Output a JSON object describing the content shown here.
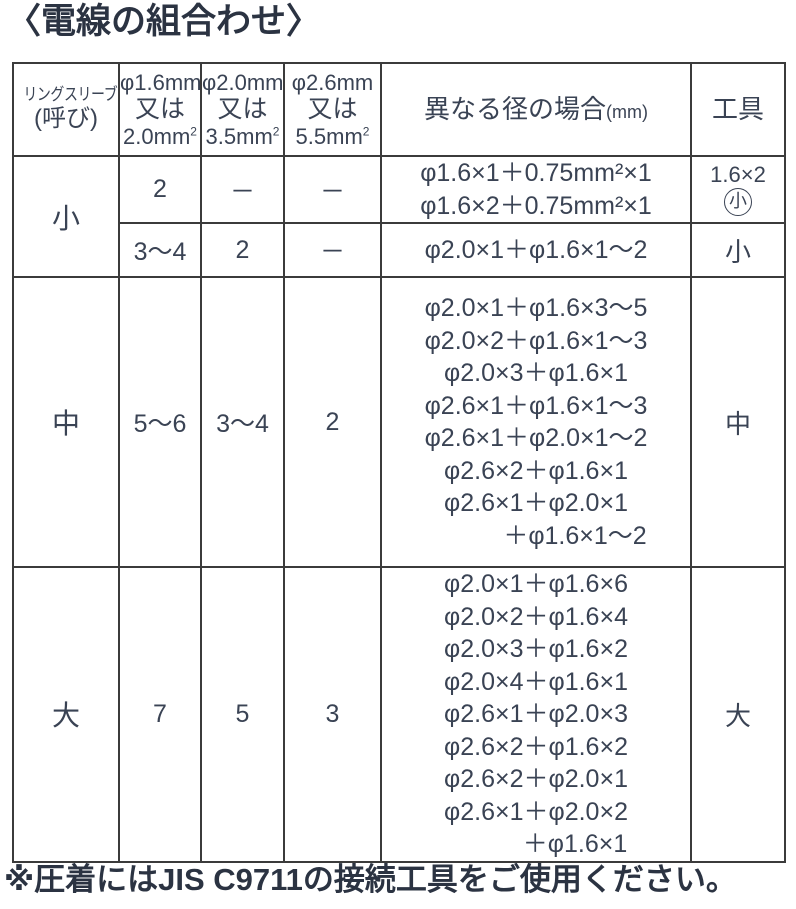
{
  "title": "〈電線の組合わせ〉",
  "table": {
    "headers": {
      "ring_sleeve_line1": "リングスリーブ",
      "ring_sleeve_line2": "(呼び)",
      "dia16_line1": "φ1.6mm",
      "dia16_line2": "又は",
      "dia16_line3": "2.0mm",
      "dia16_sup": "2",
      "dia20_line1": "φ2.0mm",
      "dia20_line2": "又は",
      "dia20_line3": "3.5mm",
      "dia20_sup": "2",
      "dia26_line1": "φ2.6mm",
      "dia26_line2": "又は",
      "dia26_line3": "5.5mm",
      "dia26_sup": "2",
      "mixed": "異なる径の場合",
      "mixed_unit": "(mm)",
      "tool": "工具"
    },
    "rows": [
      {
        "sleeve": "小",
        "subrows": [
          {
            "dia16": "2",
            "dia20": "－",
            "dia26": "－",
            "mixed_lines": [
              "φ1.6×1＋0.75mm²×1",
              "φ1.6×2＋0.75mm²×1"
            ],
            "tool_line1": "1.6×2",
            "tool_line2": "小"
          },
          {
            "dia16": "3～4",
            "dia20": "2",
            "dia26": "－",
            "mixed_lines": [
              "φ2.0×1＋φ1.6×1～2"
            ],
            "tool": "小"
          }
        ]
      },
      {
        "sleeve": "中",
        "dia16": "5～6",
        "dia20": "3～4",
        "dia26": "2",
        "mixed_lines": [
          "φ2.0×1＋φ1.6×3～5",
          "φ2.0×2＋φ1.6×1～3",
          "φ2.0×3＋φ1.6×1",
          "φ2.6×1＋φ1.6×1～3",
          "φ2.6×1＋φ2.0×1～2",
          "φ2.6×2＋φ1.6×1",
          "φ2.6×1＋φ2.0×1",
          "＋φ1.6×1～2"
        ],
        "mixed_last_indented": true,
        "tool": "中"
      },
      {
        "sleeve": "大",
        "dia16": "7",
        "dia20": "5",
        "dia26": "3",
        "mixed_lines": [
          "φ2.0×1＋φ1.6×6",
          "φ2.0×2＋φ1.6×4",
          "φ2.0×3＋φ1.6×2",
          "φ2.0×4＋φ1.6×1",
          "φ2.6×1＋φ2.0×3",
          "φ2.6×2＋φ1.6×2",
          "φ2.6×2＋φ2.0×1",
          "φ2.6×1＋φ2.0×2",
          "＋φ1.6×1"
        ],
        "mixed_last_indented": true,
        "tool": "大"
      }
    ]
  },
  "footnote": "※圧着にはJIS C9711の接続工具をご使用ください。",
  "colors": {
    "text": "#2b3342",
    "table_text": "#3a4354",
    "border": "#3b3b3b",
    "background": "#ffffff"
  }
}
